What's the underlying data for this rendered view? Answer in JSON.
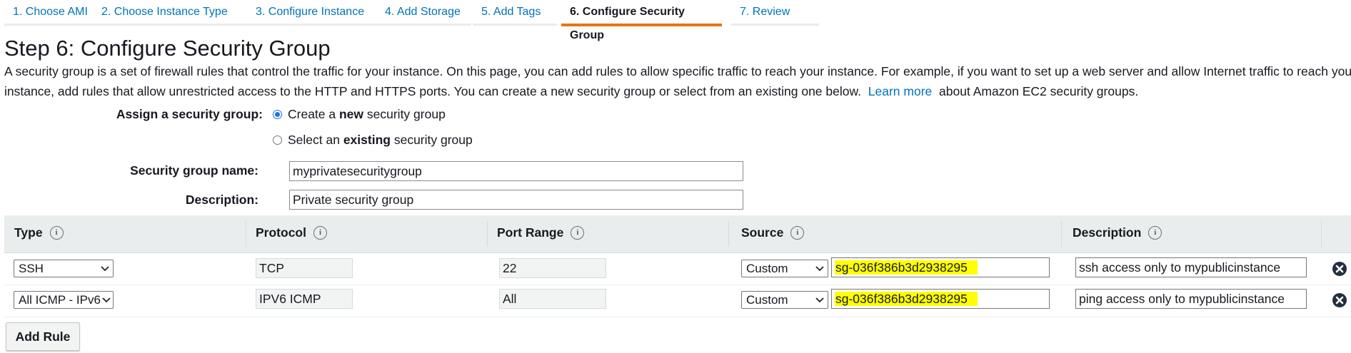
{
  "wizard": {
    "tabs": [
      {
        "label": "1. Choose AMI"
      },
      {
        "label": "2. Choose Instance Type"
      },
      {
        "label": "3. Configure Instance"
      },
      {
        "label": "4. Add Storage"
      },
      {
        "label": "5. Add Tags"
      },
      {
        "label": "6. Configure Security Group",
        "active": true
      },
      {
        "label": "7. Review"
      }
    ]
  },
  "page": {
    "title": "Step 6: Configure Security Group",
    "intro_line1": "A security group is a set of firewall rules that control the traffic for your instance. On this page, you can add rules to allow specific traffic to reach your instance. For example, if you want to set up a web server and allow Internet traffic to reach you",
    "intro_line2_pre": "instance, add rules that allow unrestricted access to the HTTP and HTTPS ports. You can create a new security group or select from an existing one below.",
    "learn_more": "Learn more",
    "intro_line2_post": "about Amazon EC2 security groups."
  },
  "form": {
    "assign_label": "Assign a security group:",
    "option_new_pre": "Create a ",
    "option_new_bold": "new",
    "option_new_post": " security group",
    "option_existing_pre": "Select an ",
    "option_existing_bold": "existing",
    "option_existing_post": " security group",
    "selected_option": "new",
    "name_label": "Security group name:",
    "name_value": "myprivatesecuritygroup",
    "description_label": "Description:",
    "description_value": "Private security group"
  },
  "rules_table": {
    "headers": {
      "type": "Type",
      "protocol": "Protocol",
      "port_range": "Port Range",
      "source": "Source",
      "description": "Description"
    },
    "info_glyph": "i",
    "rows": [
      {
        "type": "SSH",
        "protocol": "TCP",
        "port_range": "22",
        "source_type": "Custom",
        "source_value": "sg-036f386b3d2938295",
        "description": "ssh access only to mypublicinstance"
      },
      {
        "type": "All ICMP - IPv6",
        "protocol": "IPV6 ICMP",
        "port_range": "All",
        "source_type": "Custom",
        "source_value": "sg-036f386b3d2938295",
        "description": "ping access only to mypublicinstance"
      }
    ],
    "highlight_color": "#ffff00"
  },
  "actions": {
    "add_rule": "Add Rule"
  },
  "colors": {
    "link": "#0073bb",
    "active_tab_underline": "#ec7211",
    "header_bg": "#eaeded"
  },
  "icons": {
    "remove": "close-circle-icon",
    "info": "info-icon",
    "dropdown": "chevron-down-icon"
  }
}
